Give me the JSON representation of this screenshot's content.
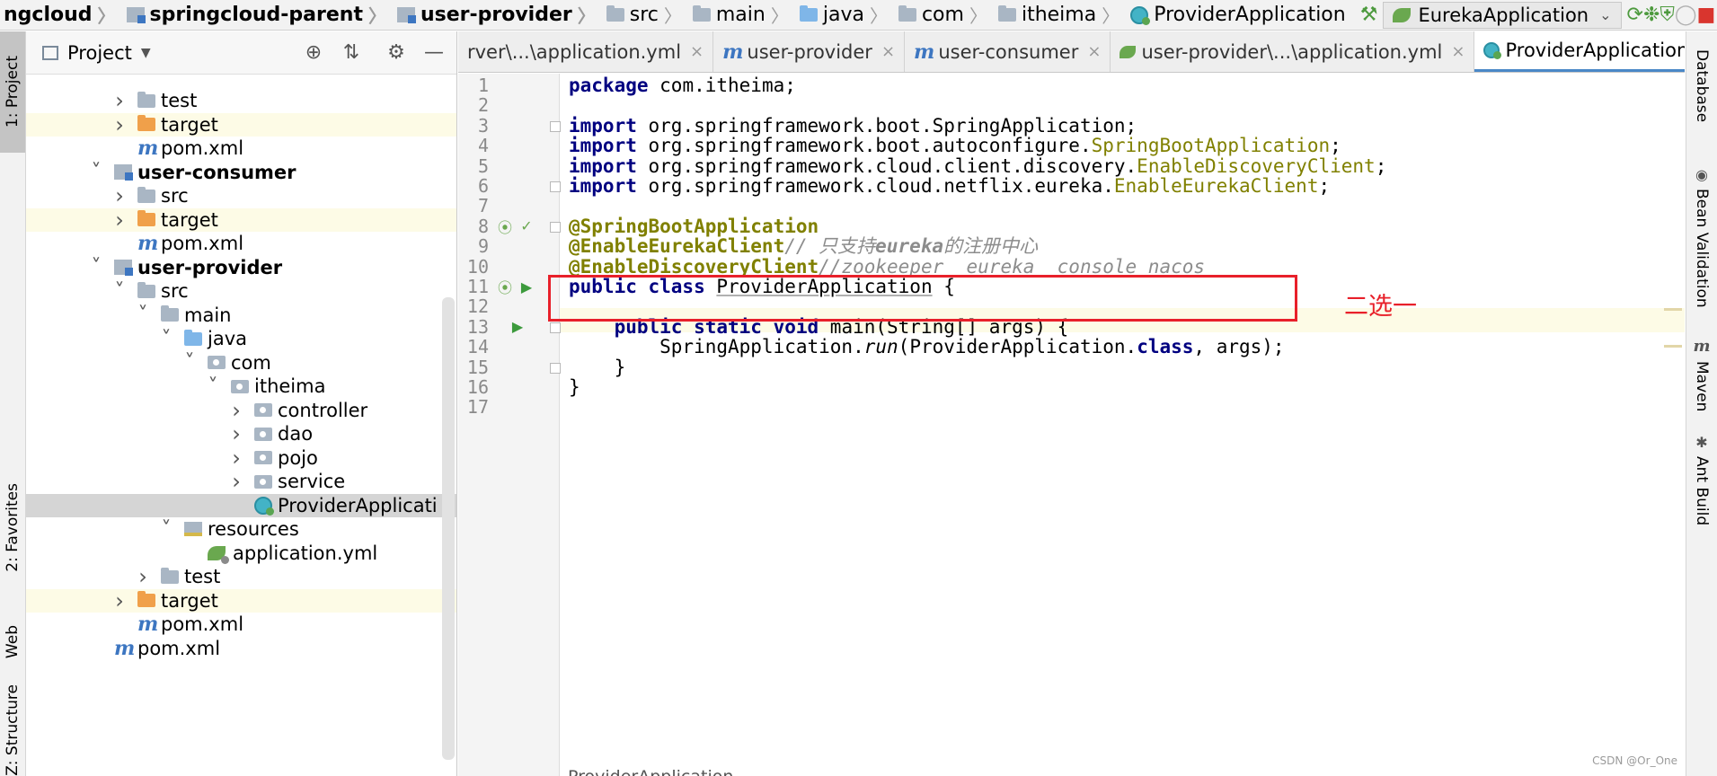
{
  "navbar": {
    "crumbs": [
      {
        "label": "ngcloud",
        "bold": true
      },
      {
        "label": "springcloud-parent",
        "bold": true
      },
      {
        "label": "user-provider",
        "bold": true
      },
      {
        "label": "src",
        "bold": false
      },
      {
        "label": "main",
        "bold": false
      },
      {
        "label": "java",
        "bold": false
      },
      {
        "label": "com",
        "bold": false
      },
      {
        "label": "itheima",
        "bold": false
      },
      {
        "label": "ProviderApplication",
        "bold": false
      }
    ],
    "run_config": "EurekaApplication"
  },
  "left_strip": {
    "project": "1: Project",
    "favorites": "2: Favorites",
    "web": "Web",
    "structure": "Z: Structure"
  },
  "project_panel": {
    "title": "Project",
    "tree": [
      {
        "label": "test",
        "depth": 3,
        "icon": "folder",
        "arrow": "right",
        "bold": false,
        "excluded": false
      },
      {
        "label": "target",
        "depth": 3,
        "icon": "folder-orange",
        "arrow": "right",
        "bold": false,
        "excluded": true
      },
      {
        "label": "pom.xml",
        "depth": 3,
        "icon": "maven",
        "arrow": "none",
        "bold": false,
        "excluded": false
      },
      {
        "label": "user-consumer",
        "depth": 2,
        "icon": "module",
        "arrow": "down",
        "bold": true,
        "excluded": false
      },
      {
        "label": "src",
        "depth": 3,
        "icon": "folder",
        "arrow": "right",
        "bold": false,
        "excluded": false
      },
      {
        "label": "target",
        "depth": 3,
        "icon": "folder-orange",
        "arrow": "right",
        "bold": false,
        "excluded": true
      },
      {
        "label": "pom.xml",
        "depth": 3,
        "icon": "maven",
        "arrow": "none",
        "bold": false,
        "excluded": false
      },
      {
        "label": "user-provider",
        "depth": 2,
        "icon": "module",
        "arrow": "down",
        "bold": true,
        "excluded": false
      },
      {
        "label": "src",
        "depth": 3,
        "icon": "folder",
        "arrow": "down",
        "bold": false,
        "excluded": false
      },
      {
        "label": "main",
        "depth": 4,
        "icon": "folder",
        "arrow": "down",
        "bold": false,
        "excluded": false
      },
      {
        "label": "java",
        "depth": 5,
        "icon": "folder-blue",
        "arrow": "down",
        "bold": false,
        "excluded": false
      },
      {
        "label": "com",
        "depth": 6,
        "icon": "package",
        "arrow": "down",
        "bold": false,
        "excluded": false
      },
      {
        "label": "itheima",
        "depth": 7,
        "icon": "package",
        "arrow": "down",
        "bold": false,
        "excluded": false
      },
      {
        "label": "controller",
        "depth": 8,
        "icon": "package",
        "arrow": "right",
        "bold": false,
        "excluded": false
      },
      {
        "label": "dao",
        "depth": 8,
        "icon": "package",
        "arrow": "right",
        "bold": false,
        "excluded": false
      },
      {
        "label": "pojo",
        "depth": 8,
        "icon": "package",
        "arrow": "right",
        "bold": false,
        "excluded": false
      },
      {
        "label": "service",
        "depth": 8,
        "icon": "package",
        "arrow": "right",
        "bold": false,
        "excluded": false
      },
      {
        "label": "ProviderApplicati",
        "depth": 8,
        "icon": "class",
        "arrow": "none",
        "bold": false,
        "excluded": false,
        "selected": true
      },
      {
        "label": "resources",
        "depth": 5,
        "icon": "resources",
        "arrow": "down",
        "bold": false,
        "excluded": false
      },
      {
        "label": "application.yml",
        "depth": 6,
        "icon": "yml",
        "arrow": "none",
        "bold": false,
        "excluded": false
      },
      {
        "label": "test",
        "depth": 4,
        "icon": "folder",
        "arrow": "right",
        "bold": false,
        "excluded": false
      },
      {
        "label": "target",
        "depth": 3,
        "icon": "folder-orange",
        "arrow": "right",
        "bold": false,
        "excluded": true
      },
      {
        "label": "pom.xml",
        "depth": 3,
        "icon": "maven",
        "arrow": "none",
        "bold": false,
        "excluded": false
      },
      {
        "label": "pom.xml",
        "depth": 2,
        "icon": "maven",
        "arrow": "none",
        "bold": false,
        "excluded": false
      }
    ]
  },
  "tabs": [
    {
      "label": "rver\\...\\application.yml",
      "icon": "none",
      "active": false
    },
    {
      "label": "user-provider",
      "icon": "maven",
      "active": false
    },
    {
      "label": "user-consumer",
      "icon": "maven",
      "active": false
    },
    {
      "label": "user-provider\\...\\application.yml",
      "icon": "yml",
      "active": false
    },
    {
      "label": "ProviderApplication.java",
      "icon": "class",
      "active": true
    }
  ],
  "editor": {
    "line_numbers": [
      "1",
      "2",
      "3",
      "4",
      "5",
      "6",
      "7",
      "8",
      "9",
      "10",
      "11",
      "12",
      "13",
      "14",
      "15",
      "16",
      "17"
    ],
    "lines": [
      [
        {
          "t": "package ",
          "c": "kw"
        },
        {
          "t": "com.itheima;",
          "c": ""
        }
      ],
      [],
      [
        {
          "t": "import ",
          "c": "kw"
        },
        {
          "t": "org.springframework.boot.SpringApplication;",
          "c": ""
        }
      ],
      [
        {
          "t": "import ",
          "c": "kw"
        },
        {
          "t": "org.springframework.boot.autoconfigure.",
          "c": ""
        },
        {
          "t": "SpringBootApplication",
          "c": "ann"
        },
        {
          "t": ";",
          "c": ""
        }
      ],
      [
        {
          "t": "import ",
          "c": "kw"
        },
        {
          "t": "org.springframework.cloud.client.discovery.",
          "c": ""
        },
        {
          "t": "EnableDiscoveryClient",
          "c": "ann"
        },
        {
          "t": ";",
          "c": ""
        }
      ],
      [
        {
          "t": "import ",
          "c": "kw"
        },
        {
          "t": "org.springframework.cloud.netflix.eureka.",
          "c": ""
        },
        {
          "t": "EnableEurekaClient",
          "c": "ann"
        },
        {
          "t": ";",
          "c": ""
        }
      ],
      [],
      [
        {
          "t": "@SpringBootApplication",
          "c": "annb"
        }
      ],
      [
        {
          "t": "@EnableEurekaClient",
          "c": "annb"
        },
        {
          "t": "// 只支持",
          "c": "cm"
        },
        {
          "t": "eureka",
          "c": "cmb"
        },
        {
          "t": "的注册中心",
          "c": "cm"
        }
      ],
      [
        {
          "t": "@EnableDiscoveryClient",
          "c": "annb"
        },
        {
          "t": "//zookeeper  eureka  console nacos",
          "c": "cm"
        }
      ],
      [
        {
          "t": "public class ",
          "c": "kw"
        },
        {
          "t": "ProviderApplication",
          "c": "ul"
        },
        {
          "t": " {",
          "c": ""
        }
      ],
      [],
      [
        {
          "t": "    public static void ",
          "c": "kw"
        },
        {
          "t": "main(String[] args) {",
          "c": ""
        }
      ],
      [
        {
          "t": "        SpringApplication.",
          "c": ""
        },
        {
          "t": "run",
          "c": "mth"
        },
        {
          "t": "(ProviderApplication.",
          "c": ""
        },
        {
          "t": "class",
          "c": "kw"
        },
        {
          "t": ", args);",
          "c": ""
        }
      ],
      [
        {
          "t": "    }",
          "c": ""
        }
      ],
      [
        {
          "t": "}",
          "c": ""
        }
      ],
      []
    ],
    "annotation_note": "二选一",
    "bottom_breadcrumb": "ProviderApplication"
  },
  "right_strip": {
    "database": "Database",
    "bean_validation": "Bean Validation",
    "maven": "Maven",
    "ant_build": "Ant Build"
  },
  "watermark": "CSDN @Or_One"
}
